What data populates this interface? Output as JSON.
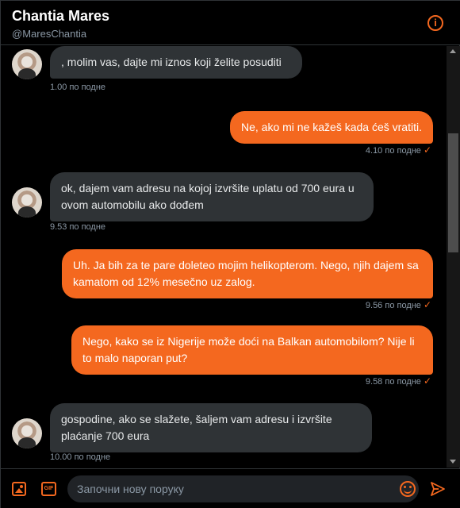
{
  "header": {
    "name": "Chantia Mares",
    "handle": "@MaresChantia",
    "info_icon": "info-icon",
    "info_glyph": "i"
  },
  "colors": {
    "accent": "#f4681f",
    "incoming_bubble": "#2f3336",
    "background": "#000000",
    "timestamp": "#8b98a5"
  },
  "messages": [
    {
      "direction": "incoming",
      "text": ", molim vas, dajte mi iznos koji želite posuditi",
      "time": "1.00 по подне"
    },
    {
      "direction": "outgoing",
      "text": "Ne, ako mi ne kažeš kada ćeš vratiti.",
      "time": "4.10 по подне",
      "status_icon": "check-icon",
      "status_glyph": "✓"
    },
    {
      "direction": "incoming",
      "text": "ok, dajem vam adresu na kojoj izvršite uplatu od 700 eura u ovom automobilu ako dođem",
      "time": "9.53 по подне"
    },
    {
      "direction": "outgoing",
      "text": "Uh. Ja bih za te pare doleteo mojim helikopterom. Nego, njih dajem sa kamatom od 12% mesečno uz zalog.",
      "time": "9.56 по подне",
      "status_icon": "check-icon",
      "status_glyph": "✓"
    },
    {
      "direction": "outgoing",
      "text": "Nego, kako se iz Nigerije može doći na Balkan automobilom? Nije li to malo naporan put?",
      "time": "9.58 по подне",
      "status_icon": "check-icon",
      "status_glyph": "✓"
    },
    {
      "direction": "incoming",
      "text": "gospodine, ako se slažete, šaljem vam adresu i izvršite plaćanje 700 eura",
      "time": "10.00 по подне"
    }
  ],
  "composer": {
    "placeholder": "Започни нову поруку",
    "value": "",
    "gif_label": "GIF",
    "media_icon": "image-icon",
    "gif_icon": "gif-icon",
    "emoji_icon": "emoji-icon",
    "send_icon": "send-icon"
  }
}
